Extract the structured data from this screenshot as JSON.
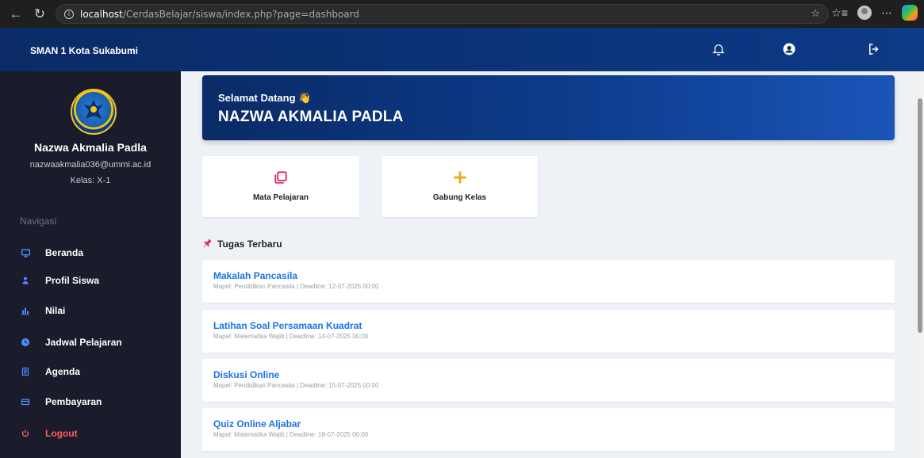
{
  "browser": {
    "url_host": "localhost",
    "url_path": "/CerdasBelajar/siswa/index.php?page=dashboard"
  },
  "header": {
    "brand": "SMAN 1 Kota Sukabumi",
    "icons": [
      "bell-icon",
      "user-icon",
      "logout-icon"
    ]
  },
  "sidebar": {
    "user_name": "Nazwa Akmalia Padla",
    "user_email": "nazwaakmalia036@ummi.ac.id",
    "user_class": "Kelas: X-1",
    "nav_heading": "Navigasi",
    "items": [
      {
        "label": "Beranda",
        "icon": "monitor-icon"
      },
      {
        "label": "Profil Siswa",
        "icon": "user-icon"
      },
      {
        "label": "Nilai",
        "icon": "chart-icon"
      },
      {
        "label": "Jadwal Pelajaran",
        "icon": "clock-icon"
      },
      {
        "label": "Agenda",
        "icon": "document-icon"
      },
      {
        "label": "Pembayaran",
        "icon": "wallet-icon"
      },
      {
        "label": "Logout",
        "icon": "power-icon"
      }
    ],
    "colors": {
      "accent": "#4f8cff",
      "logout": "#ff5a5a",
      "bg": "#1b1c2b"
    }
  },
  "main": {
    "welcome_greeting": "Selamat Datang 👋",
    "welcome_name": "NAZWA AKMALIA PADLA",
    "quick_actions": [
      {
        "label": "Mata Pelajaran",
        "icon": "copy-icon",
        "color": "#e0245e"
      },
      {
        "label": "Gabung Kelas",
        "icon": "plus-icon",
        "color": "#f5a623"
      }
    ],
    "section_title": "Tugas Terbaru",
    "tasks": [
      {
        "title": "Makalah Pancasila",
        "meta": "Mapel: Pendidikan Pancasila | Deadline: 12-07-2025 00:00"
      },
      {
        "title": "Latihan Soal Persamaan Kuadrat",
        "meta": "Mapel: Matematika Wajib | Deadline: 14-07-2025 00:00"
      },
      {
        "title": "Diskusi Online",
        "meta": "Mapel: Pendidikan Pancasila | Deadline: 15-07-2025 00:00"
      },
      {
        "title": "Quiz Online Aljabar",
        "meta": "Mapel: Matematika Wajib | Deadline: 18-07-2025 00:00"
      }
    ]
  }
}
